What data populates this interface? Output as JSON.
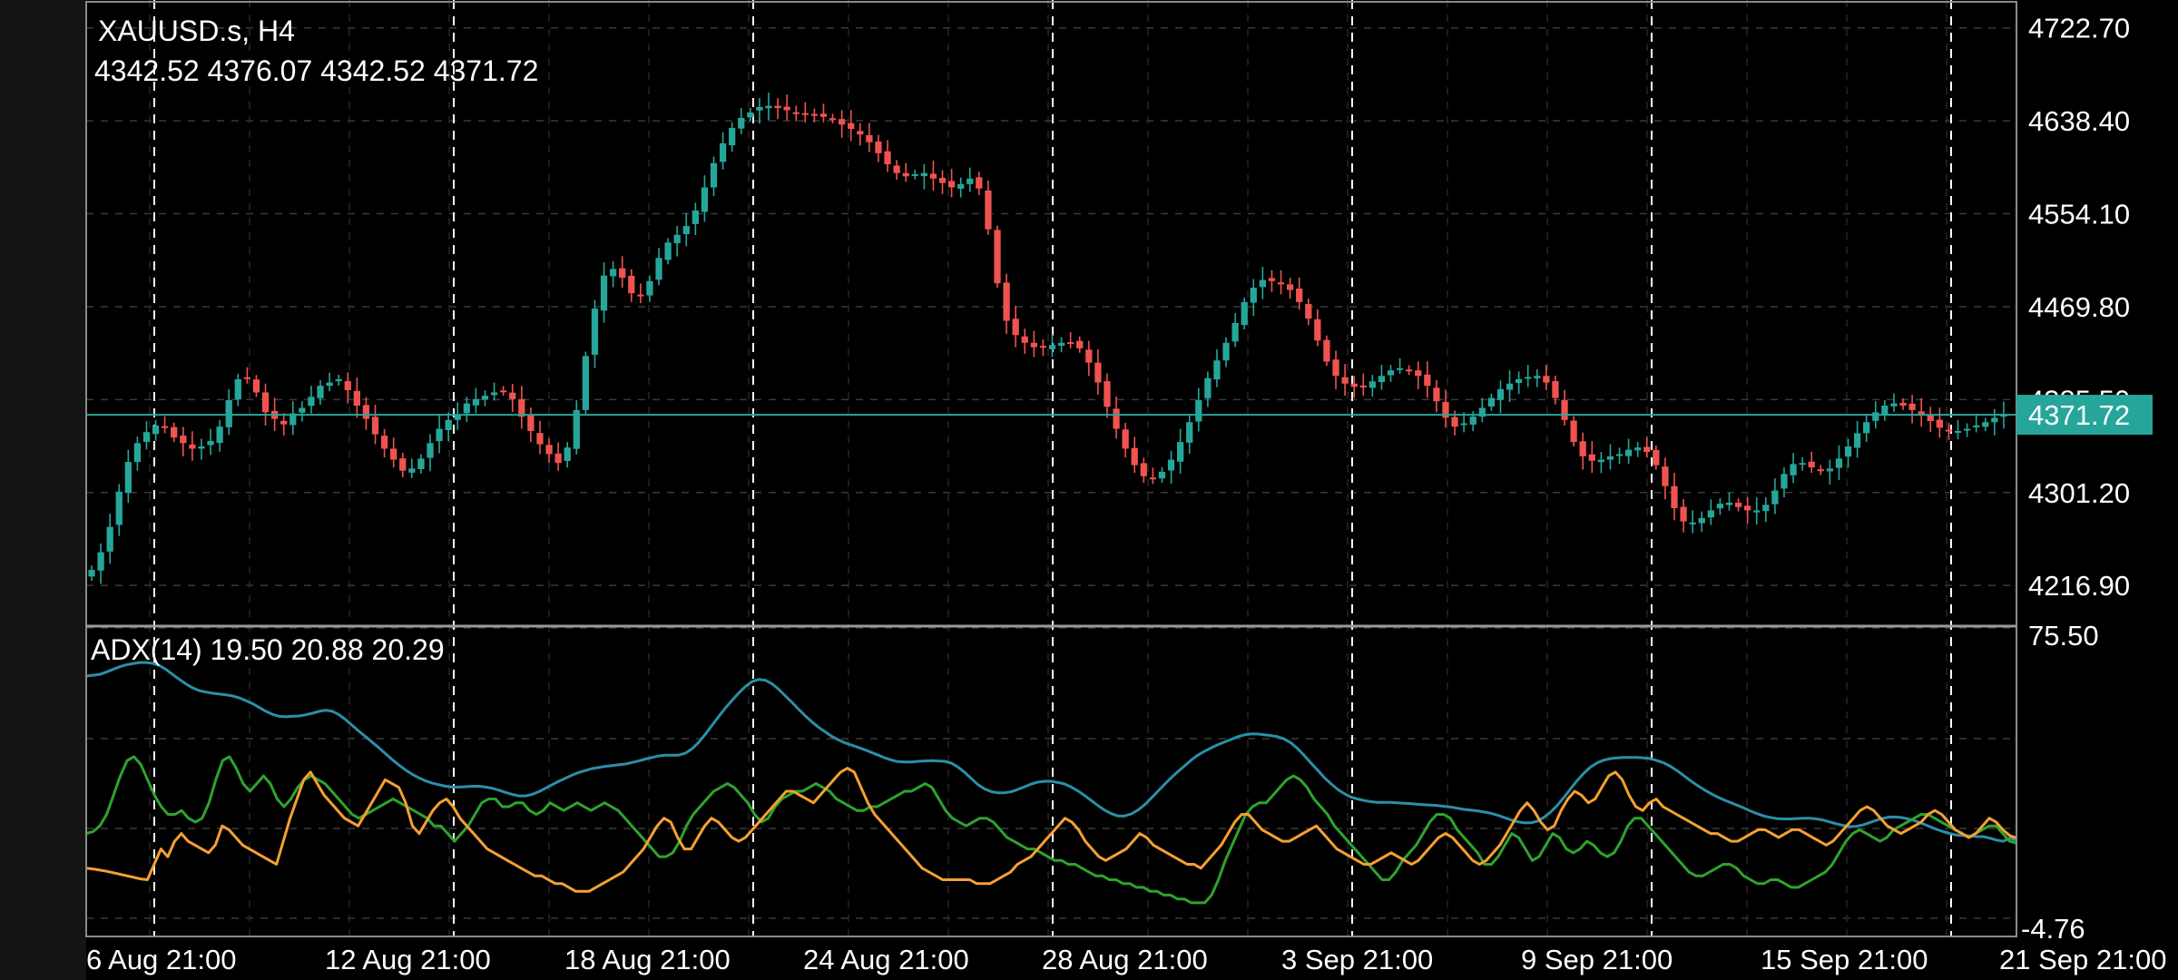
{
  "header": {
    "symbol_timeframe": "XAUUSD.s, H4",
    "ohlc": "4342.52 4376.07 4342.52 4371.72"
  },
  "price_panel": {
    "current_price_label": "4371.72",
    "price_axis_labels": [
      "4722.70",
      "4638.40",
      "4554.10",
      "4469.80",
      "4385.50",
      "4301.20",
      "4216.90"
    ]
  },
  "adx_panel": {
    "label": "ADX(14) 19.50 20.88 20.29",
    "axis_max_label": "75.50",
    "axis_min_label": "-4.76"
  },
  "time_axis": {
    "labels": [
      "6 Aug 21:00",
      "12 Aug 21:00",
      "18 Aug 21:00",
      "24 Aug 21:00",
      "28 Aug 21:00",
      "3 Sep 21:00",
      "9 Sep 21:00",
      "15 Sep 21:00",
      "21 Sep 21:00"
    ]
  },
  "colors": {
    "background": "#000000",
    "bull_candle": "#26a69a",
    "bear_candle": "#ef5350",
    "current_price_line": "#26a69a",
    "adx_line": "#2b8fa8",
    "plus_di_line": "#2ea32e",
    "minus_di_line": "#f5a031",
    "grid": "#3a3a3a",
    "separator_lines": "#ffffff",
    "axis_text": "#ffffff"
  },
  "chart_data": [
    {
      "type": "candlestick",
      "title": "XAUUSD.s, H4",
      "ylim": [
        4180,
        4748
      ],
      "y_ticks": [
        4722.7,
        4638.4,
        4554.1,
        4469.8,
        4385.5,
        4301.2,
        4216.9
      ],
      "grid": true,
      "current_price": 4371.72,
      "series": [
        {
          "name": "close",
          "values": [
            4231,
            4247,
            4270,
            4302,
            4329,
            4346,
            4356,
            4362,
            4360,
            4351,
            4346,
            4341,
            4343,
            4348,
            4361,
            4385,
            4404,
            4405,
            4392,
            4374,
            4368,
            4363,
            4373,
            4378,
            4388,
            4398,
            4401,
            4404,
            4394,
            4380,
            4368,
            4354,
            4341,
            4331,
            4321,
            4323,
            4332,
            4346,
            4359,
            4367,
            4372,
            4382,
            4386,
            4389,
            4392,
            4393,
            4386,
            4370,
            4357,
            4345,
            4336,
            4328,
            4342,
            4376,
            4425,
            4468,
            4498,
            4504,
            4496,
            4482,
            4480,
            4493,
            4514,
            4528,
            4535,
            4543,
            4557,
            4578,
            4600,
            4618,
            4632,
            4641,
            4646,
            4651,
            4652,
            4650,
            4648,
            4646,
            4644,
            4643,
            4642,
            4640,
            4635,
            4631,
            4626,
            4619,
            4609,
            4599,
            4591,
            4588,
            4590,
            4591,
            4586,
            4582,
            4578,
            4581,
            4586,
            4577,
            4540,
            4491,
            4457,
            4444,
            4437,
            4433,
            4433,
            4435,
            4437,
            4437,
            4432,
            4419,
            4401,
            4379,
            4359,
            4341,
            4326,
            4316,
            4314,
            4320,
            4331,
            4347,
            4365,
            4385,
            4405,
            4421,
            4437,
            4455,
            4474,
            4487,
            4494,
            4493,
            4490,
            4485,
            4474,
            4459,
            4439,
            4420,
            4407,
            4400,
            4397,
            4398,
            4402,
            4407,
            4412,
            4414,
            4412,
            4407,
            4398,
            4384,
            4369,
            4361,
            4364,
            4370,
            4378,
            4387,
            4395,
            4400,
            4404,
            4406,
            4407,
            4401,
            4387,
            4367,
            4347,
            4334,
            4330,
            4331,
            4334,
            4336,
            4340,
            4342,
            4338,
            4326,
            4307,
            4287,
            4275,
            4274,
            4278,
            4285,
            4291,
            4292,
            4288,
            4285,
            4285,
            4290,
            4303,
            4318,
            4327,
            4328,
            4324,
            4321,
            4323,
            4332,
            4343,
            4355,
            4365,
            4374,
            4380,
            4382,
            4380,
            4376,
            4372,
            4366,
            4360,
            4357,
            4357,
            4359,
            4362,
            4365,
            4369,
            4371.72
          ]
        }
      ]
    },
    {
      "type": "line",
      "title": "ADX(14) 19.50 20.88 20.29",
      "ylim": [
        -4.76,
        75.5
      ],
      "grid": true,
      "series": [
        {
          "name": "ADX",
          "values": [
            63,
            63.2,
            63.4,
            64,
            64.7,
            65.4,
            65.9,
            66.2,
            66.5,
            66.5,
            66.3,
            65.7,
            64.7,
            63.4,
            62.1,
            60.9,
            59.9,
            59.2,
            58.8,
            58.5,
            58.3,
            58.1,
            57.8,
            57.3,
            56.6,
            55.8,
            54.8,
            53.8,
            53,
            52.5,
            52.4,
            52.5,
            52.6,
            52.9,
            53.3,
            53.8,
            54.1,
            53.8,
            52.9,
            51.6,
            50.1,
            48.6,
            47.2,
            45.7,
            44.3,
            42.7,
            41.2,
            39.8,
            38.5,
            37.4,
            36.5,
            35.7,
            35.1,
            34.7,
            34.3,
            34.1,
            34.1,
            34.2,
            34.3,
            34.3,
            34.1,
            33.8,
            33.3,
            32.7,
            32.2,
            31.8,
            31.8,
            32.2,
            32.9,
            33.8,
            34.7,
            35.6,
            36.4,
            37.2,
            37.9,
            38.4,
            38.9,
            39.2,
            39.5,
            39.7,
            39.9,
            40.1,
            40.5,
            40.9,
            41.4,
            41.8,
            42.2,
            42.4,
            42.4,
            42.4,
            42.9,
            44,
            45.7,
            47.8,
            50.1,
            52.4,
            54.6,
            56.6,
            58.5,
            60.2,
            61.5,
            62.1,
            61.9,
            61,
            59.6,
            57.9,
            56.2,
            54.4,
            52.7,
            51.1,
            49.7,
            48.5,
            47.3,
            46.4,
            45.6,
            45,
            44.4,
            43.8,
            43.1,
            42.4,
            41.7,
            41.1,
            40.7,
            40.6,
            40.6,
            40.8,
            40.9,
            41,
            40.9,
            40.8,
            40.3,
            39.3,
            37.9,
            36.3,
            34.7,
            33.6,
            32.9,
            32.6,
            32.6,
            32.9,
            33.5,
            34.2,
            34.9,
            35.4,
            35.6,
            35.6,
            35.3,
            34.9,
            34.1,
            33.1,
            31.9,
            30.6,
            29.3,
            28.1,
            27.2,
            26.6,
            26.6,
            27.1,
            28.1,
            29.5,
            31.2,
            33,
            34.8,
            36.5,
            38.1,
            39.6,
            41.1,
            42.4,
            43.4,
            44.3,
            45.1,
            45.8,
            46.5,
            47.2,
            47.7,
            47.9,
            47.9,
            47.7,
            47.5,
            47.2,
            46.6,
            45.6,
            44.1,
            42.3,
            40.4,
            38.5,
            36.6,
            35,
            33.5,
            32.4,
            31.5,
            31,
            30.6,
            30.3,
            30.1,
            30.1,
            30.1,
            30,
            29.9,
            29.8,
            29.6,
            29.5,
            29.4,
            29.3,
            29.1,
            28.9,
            28.6,
            28.3,
            28.1,
            27.9,
            27.6,
            27.3,
            26.8,
            26.2,
            25.6,
            25.1,
            24.8,
            24.8,
            25.2,
            26.2,
            27.6,
            29.3,
            31.4,
            33.6,
            35.8,
            37.7,
            39.3,
            40.4,
            41.1,
            41.5,
            41.7,
            41.8,
            41.8,
            41.8,
            41.7,
            41.5,
            41,
            40.4,
            39.5,
            38.4,
            37.1,
            35.8,
            34.6,
            33.5,
            32.5,
            31.6,
            30.8,
            30.1,
            29.4,
            28.7,
            27.9,
            27.2,
            26.6,
            26.2,
            25.9,
            25.8,
            25.8,
            25.9,
            26,
            26,
            25.8,
            25.5,
            25,
            24.5,
            24.1,
            23.8,
            23.9,
            24.3,
            24.9,
            25.5,
            26,
            26.3,
            26.3,
            26.1,
            25.7,
            25.2,
            24.5,
            23.8,
            23.1,
            22.5,
            22,
            21.6,
            21.5,
            21.4,
            21.2,
            21.2,
            20.8,
            20.3,
            20,
            20.8,
            20.29
          ]
        },
        {
          "name": "+DI",
          "values": [
            22,
            22.5,
            24,
            27,
            32,
            37,
            41,
            42,
            40,
            36,
            32,
            29,
            27,
            27,
            28,
            26,
            25,
            26,
            30,
            36,
            41,
            42,
            39,
            35,
            33,
            35,
            37,
            35,
            31,
            29,
            31,
            34,
            36,
            37,
            36,
            35,
            33,
            31,
            29,
            27,
            26,
            27,
            28,
            29,
            30,
            31,
            30,
            29,
            28,
            27,
            26,
            24,
            24,
            22,
            20,
            22,
            24,
            27,
            30,
            31,
            31,
            29,
            29,
            30,
            30,
            28,
            27,
            28,
            30,
            29,
            28,
            29,
            30,
            29,
            28,
            29,
            30,
            29,
            28,
            26,
            24,
            22,
            20,
            18,
            16,
            16,
            17,
            20,
            24,
            27,
            29,
            31,
            33,
            34,
            35,
            34,
            32,
            30,
            27,
            25,
            26,
            29,
            31,
            32,
            33,
            33,
            34,
            35,
            34,
            33,
            31,
            30,
            29,
            28,
            28,
            29,
            29,
            30,
            31,
            32,
            33,
            33,
            34,
            35,
            34,
            31,
            28,
            26,
            25,
            24,
            25,
            26,
            26,
            25,
            23,
            21,
            20,
            19,
            18,
            18,
            17,
            16,
            15,
            15,
            14,
            14,
            13,
            12,
            11,
            11,
            10,
            10,
            9,
            9,
            8,
            8,
            7,
            7,
            6,
            6,
            5,
            5,
            4,
            4,
            4,
            6,
            10,
            15,
            19,
            23,
            27,
            29,
            30,
            30,
            32,
            34,
            36,
            37,
            36,
            34,
            31,
            29,
            27,
            24,
            22,
            20,
            18,
            16,
            14,
            12,
            10,
            10,
            12,
            15,
            17,
            19,
            22,
            25,
            27,
            27,
            26,
            23,
            21,
            19,
            17,
            14,
            14,
            16,
            19,
            22,
            21,
            18,
            15,
            16,
            19,
            22,
            21,
            18,
            17,
            18,
            20,
            19,
            17,
            16,
            17,
            20,
            24,
            26,
            26,
            24,
            22,
            20,
            18,
            16,
            14,
            12,
            11,
            11,
            12,
            13,
            14,
            14,
            13,
            11,
            10,
            9,
            9,
            10,
            10,
            9,
            8,
            8,
            9,
            10,
            11,
            12,
            14,
            17,
            20,
            22,
            23,
            22,
            21,
            20,
            21,
            23,
            24,
            25,
            26,
            27,
            27,
            26,
            25,
            24,
            23,
            22,
            21,
            22,
            23,
            24,
            24,
            22,
            20,
            19.5
          ]
        },
        {
          "name": "-DI",
          "values": [
            13,
            12.8,
            12.5,
            12.2,
            11.8,
            11.4,
            11,
            10.6,
            10.2,
            10,
            14,
            18,
            16,
            20,
            22,
            20,
            19,
            18,
            17,
            19,
            24,
            23,
            21,
            19,
            18,
            17,
            16,
            15,
            14,
            20,
            26,
            31,
            36,
            38,
            35,
            32,
            30,
            28,
            26,
            25,
            24,
            27,
            30,
            33,
            36,
            35,
            34,
            30,
            24,
            22,
            25,
            28,
            30,
            31,
            29,
            26,
            24,
            22,
            20,
            18,
            17,
            16,
            15,
            14,
            13,
            12,
            11,
            11,
            10,
            9,
            9,
            8,
            7,
            7,
            7,
            8,
            9,
            10,
            11,
            12,
            14,
            16,
            18,
            21,
            24,
            26,
            25,
            21,
            18,
            18,
            21,
            24,
            26,
            25,
            23,
            21,
            20,
            21,
            23,
            25,
            27,
            29,
            31,
            33,
            33,
            32,
            31,
            30,
            32,
            34,
            36,
            38,
            39,
            38,
            34,
            30,
            27,
            25,
            23,
            21,
            19,
            17,
            15,
            13,
            12,
            11,
            10,
            10,
            10,
            10,
            10,
            9,
            9,
            9,
            10,
            11,
            12,
            14,
            15,
            16,
            18,
            20,
            22,
            24,
            26,
            25,
            23,
            20,
            18,
            16,
            15,
            16,
            17,
            18,
            20,
            22,
            21,
            19,
            18,
            17,
            16,
            15,
            14,
            14,
            13,
            15,
            17,
            19,
            22,
            25,
            27,
            27,
            25,
            23,
            22,
            21,
            20,
            20,
            21,
            22,
            23,
            24,
            22,
            20,
            18,
            17,
            16,
            15,
            14,
            14,
            15,
            16,
            17,
            16,
            15,
            14,
            15,
            17,
            19,
            21,
            22,
            21,
            19,
            17,
            15,
            14,
            15,
            17,
            19,
            22,
            25,
            28,
            30,
            28,
            25,
            23,
            24,
            28,
            31,
            33,
            32,
            30,
            31,
            34,
            37,
            38,
            36,
            32,
            29,
            28,
            30,
            31,
            29,
            28,
            27,
            26,
            25,
            24,
            23,
            22,
            22,
            21,
            20,
            20,
            21,
            22,
            23,
            23,
            22,
            21,
            22,
            23,
            23,
            22,
            21,
            20,
            19,
            20,
            22,
            24,
            26,
            28,
            29,
            28,
            26,
            24,
            23,
            22,
            23,
            24,
            25,
            27,
            28,
            27,
            25,
            23,
            22,
            21,
            22,
            24,
            26,
            25,
            23,
            21.5,
            20.88
          ]
        }
      ]
    }
  ]
}
